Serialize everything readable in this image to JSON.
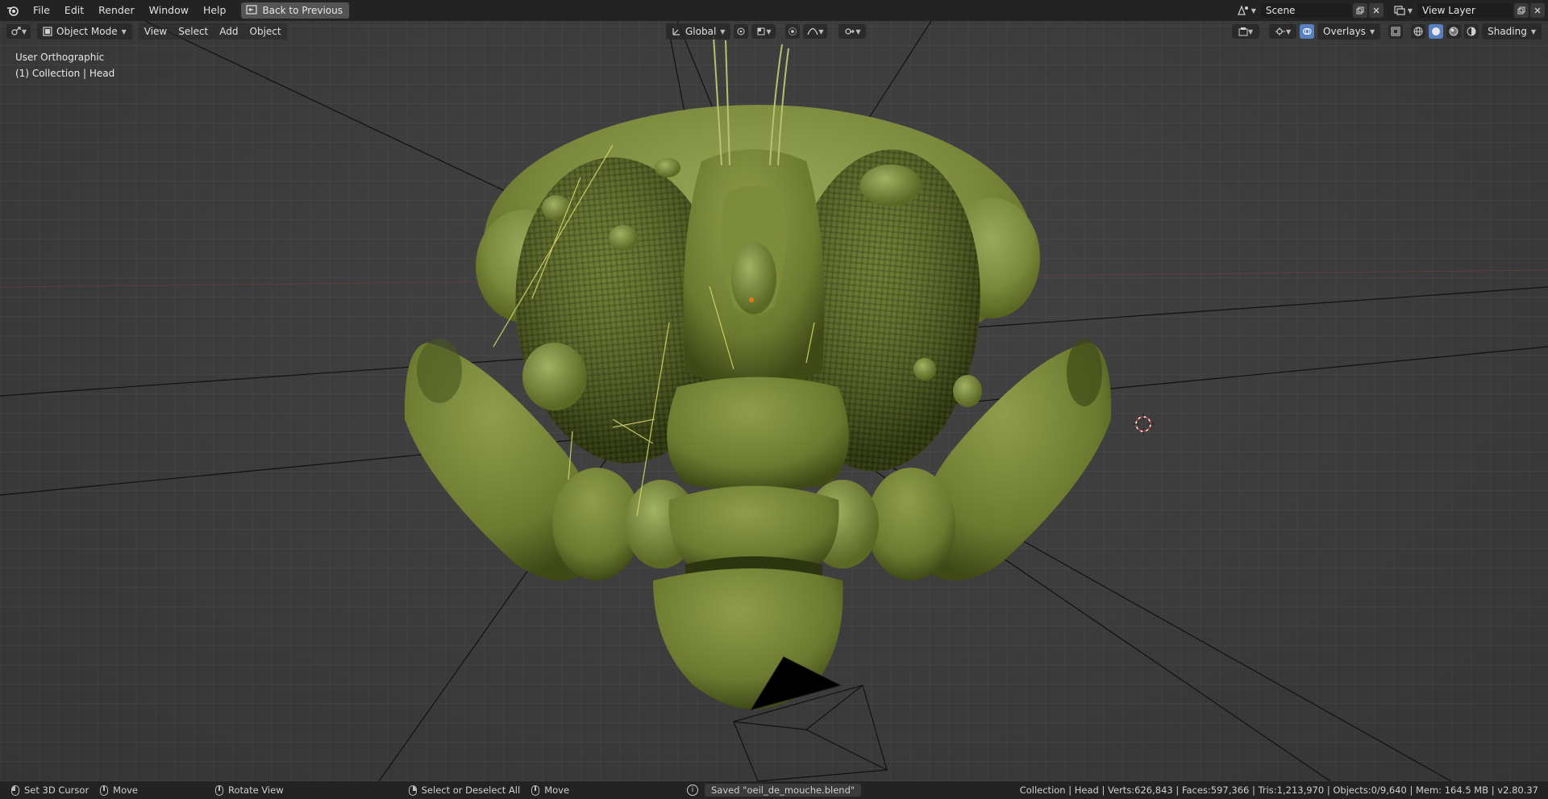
{
  "menubar": {
    "items": [
      "File",
      "Edit",
      "Render",
      "Window",
      "Help"
    ],
    "back_button": "Back to Previous",
    "scene": "Scene",
    "view_layer": "View Layer"
  },
  "viewport_header": {
    "mode": "Object Mode",
    "menus": [
      "View",
      "Select",
      "Add",
      "Object"
    ],
    "transform_orientation": "Global",
    "overlays": "Overlays",
    "shading": "Shading"
  },
  "viewport_info": {
    "view": "User Orthographic",
    "collection": "(1) Collection | Head"
  },
  "statusbar": {
    "set_cursor": "Set 3D Cursor",
    "move": "Move",
    "rotate_view": "Rotate View",
    "select_all": "Select or Deselect All",
    "move2": "Move",
    "saved": "Saved \"oeil_de_mouche.blend\"",
    "stats": "Collection | Head | Verts:626,843 | Faces:597,366 | Tris:1,213,970 | Objects:0/9,640 | Mem: 164.5 MB | v2.80.37"
  },
  "colors": {
    "model": "#6b7a35",
    "model_light": "#8e9c4f",
    "model_dark": "#3e4a1a",
    "eye": "#4a5524",
    "active_shading": "#5680c2"
  }
}
